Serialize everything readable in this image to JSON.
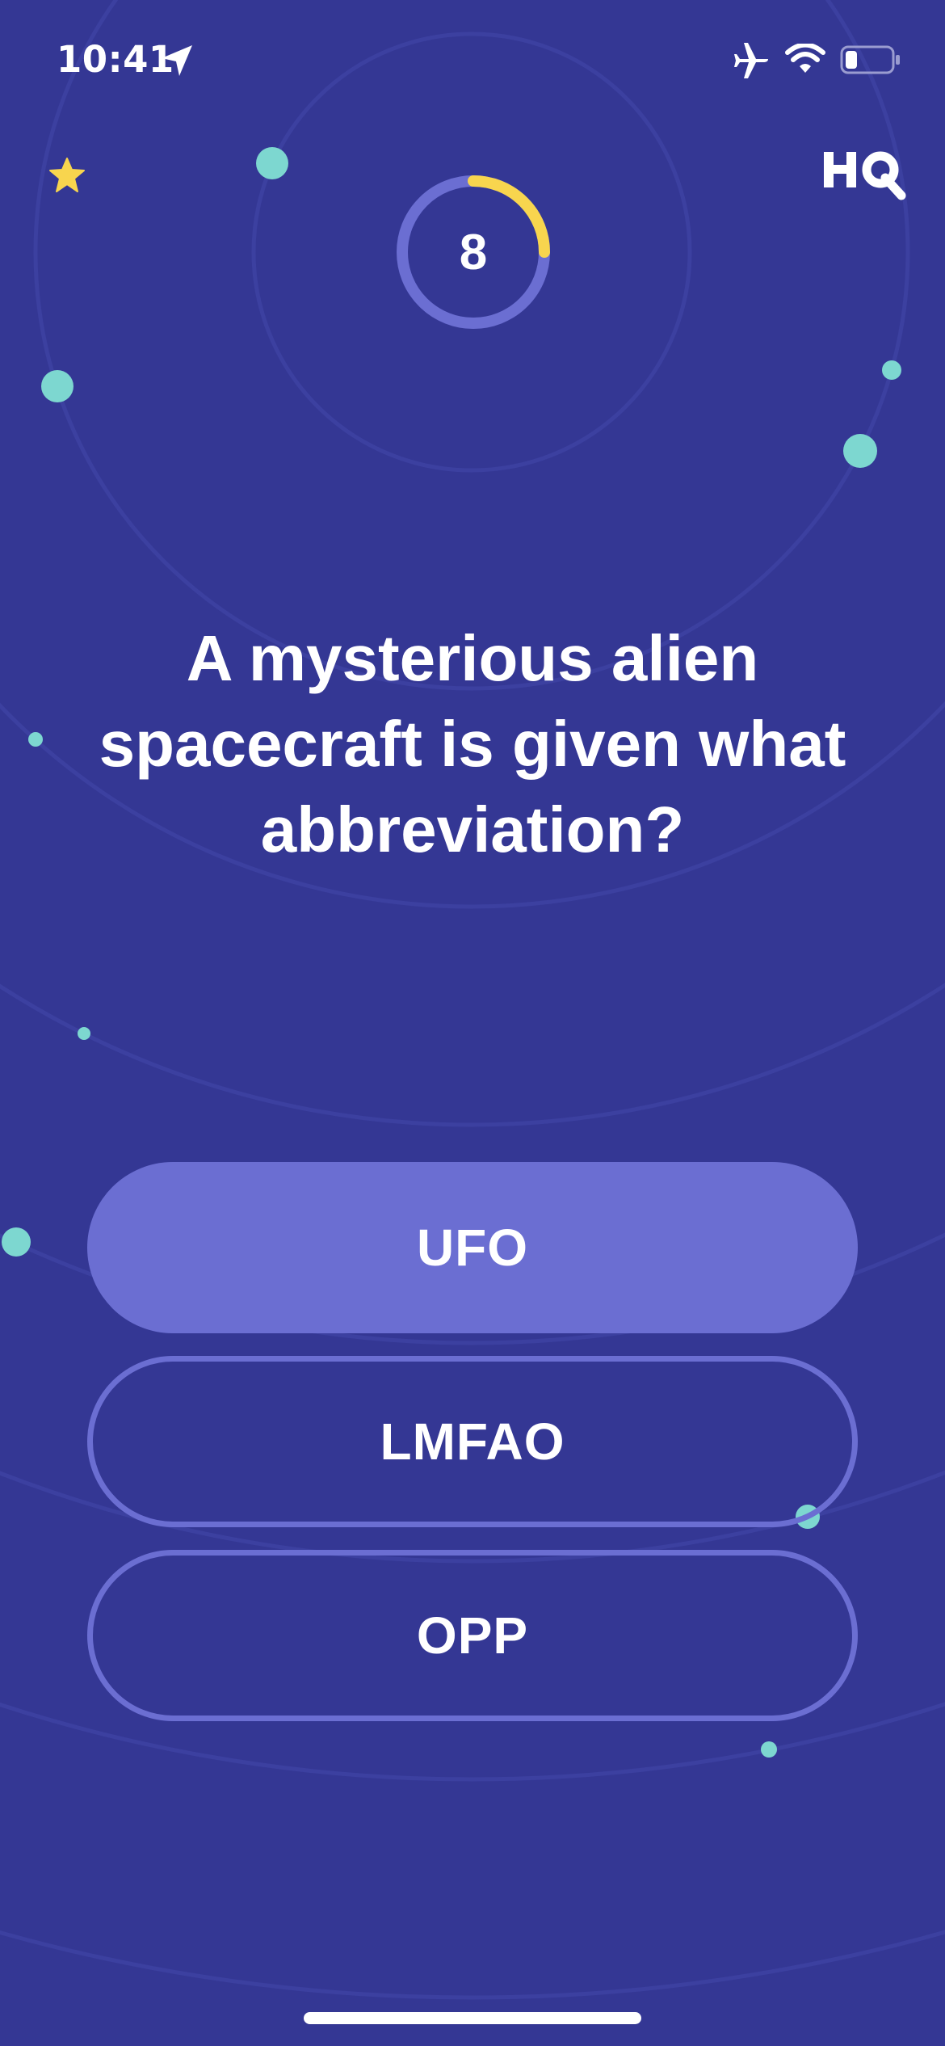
{
  "status_bar": {
    "time": "10:41",
    "icons": [
      "location-arrow-icon",
      "airplane-icon",
      "wifi-icon",
      "battery-icon"
    ]
  },
  "header": {
    "logo": "HQ",
    "icons": [
      "star-icon"
    ]
  },
  "timer": {
    "seconds_remaining": "8",
    "progress_fraction": 0.25
  },
  "question": {
    "text": "A mysterious alien spacecraft is given what abbreviation?"
  },
  "answers": [
    {
      "label": "UFO",
      "selected": true
    },
    {
      "label": "LMFAO",
      "selected": false
    },
    {
      "label": "OPP",
      "selected": false
    }
  ],
  "colors": {
    "background": "#343794",
    "accent_purple": "#6b6ed2",
    "timer_yellow": "#f8d54e",
    "dot_teal": "#7dd7d0",
    "star_yellow": "#f8d54e"
  }
}
